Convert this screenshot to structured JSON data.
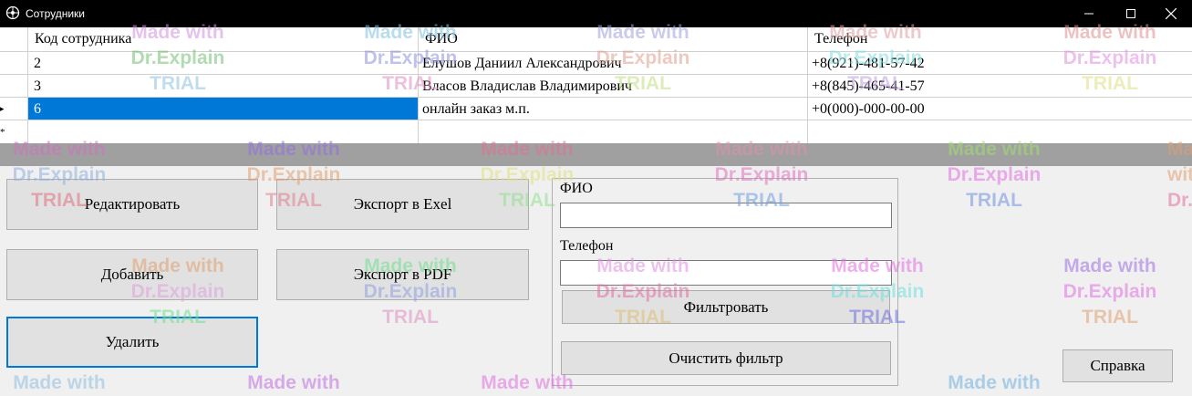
{
  "window": {
    "title": "Сотрудники"
  },
  "grid": {
    "columns": [
      "Код сотрудника",
      "ФИО",
      "Телефон"
    ],
    "rows": [
      {
        "id": "2",
        "fio": "Елушов Даниил Александрович",
        "phone": "+8(921)-481-57-42"
      },
      {
        "id": "3",
        "fio": "Власов Владислав Владимирович",
        "phone": "+8(845)-465-41-57"
      },
      {
        "id": "6",
        "fio": "онлайн заказ м.п.",
        "phone": "+0(000)-000-00-00"
      }
    ],
    "current_row_marker": "▸",
    "new_row_marker": "*"
  },
  "buttons": {
    "edit": "Редактировать",
    "export_excel": "Экспорт в Exel",
    "add": "Добавить",
    "export_pdf": "Экспорт в PDF",
    "delete": "Удалить",
    "filter": "Фильтровать",
    "clear_filter": "Очистить фильтр",
    "help": "Справка"
  },
  "filter": {
    "fio_label": "ФИО",
    "fio_value": "",
    "phone_label": "Телефон",
    "phone_value": ""
  },
  "watermark": {
    "line1": "Made with",
    "line2": "Dr.Explain",
    "line3": "TRIAL"
  }
}
